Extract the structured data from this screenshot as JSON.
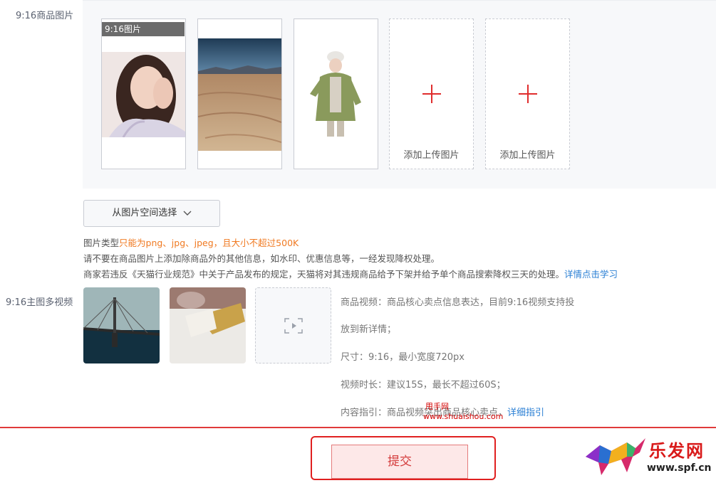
{
  "image_section": {
    "label": "9:16商品图片",
    "first_tag": "9:16图片",
    "add_label": "添加上传图片"
  },
  "select_button": {
    "label": "从图片空间选择"
  },
  "notes": {
    "line1_prefix": "图片类型",
    "line1_warn": "只能为png、jpg、jpeg，且大小不超过500K",
    "line2": "请不要在商品图片上添加除商品外的其他信息，如水印、优惠信息等，一经发现降权处理。",
    "line3": "商家若违反《天猫行业规范》中关于产品发布的规定，天猫将对其违规商品给予下架并给予单个商品搜索降权三天的处理。",
    "line3_link": "详情点击学习"
  },
  "video_section": {
    "label": "9:16主图多视频",
    "info1": "商品视频：商品核心卖点信息表达，目前9:16视频支持投",
    "info2": "放到新详情；",
    "info3": "尺寸：9:16，最小宽度720px",
    "info4": "视频时长：建议15S，最长不超过60S；",
    "info5": "内容指引：商品视频突出商品核心卖点，",
    "info5_link": "详细指引"
  },
  "submit": {
    "label": "提交"
  },
  "watermark": {
    "site": "甩手网",
    "url": "www.shuaishou.com",
    "logo_text": "乐发网",
    "logo_url": "www.spf.cn"
  },
  "colors": {
    "accent_red": "#e02d2d",
    "link_blue": "#2a7fd4",
    "warn_orange": "#f07a22"
  }
}
